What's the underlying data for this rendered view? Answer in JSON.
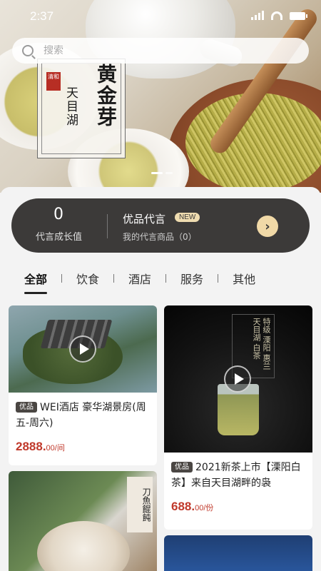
{
  "status_bar": {
    "time": "2:37"
  },
  "search": {
    "placeholder": "搜索"
  },
  "banner": {
    "seal_text": "清和",
    "brand_vertical": "天目湖",
    "product_vertical": "黄金芽"
  },
  "growth_card": {
    "value": "0",
    "value_label": "代言成长值",
    "title": "优品代言",
    "badge": "NEW",
    "subtitle": "我的代言商品（0）",
    "arrow": "›"
  },
  "tabs": [
    "全部",
    "饮食",
    "酒店",
    "服务",
    "其他"
  ],
  "products": [
    {
      "tag": "优品",
      "name": "WEI酒店 豪华湖景房(周五-周六)",
      "price": "2888.",
      "price_small": "00/间"
    },
    {
      "tag": "优品",
      "name": "2021新茶上市【溧阳白茶】来自天目湖畔的袅",
      "price": "688.",
      "price_small": "00/份",
      "image_text": "特级 溧阳 惠兰 天目湖 白茶"
    },
    {
      "image_text": "刀魚餛飩"
    }
  ],
  "colors": {
    "dark_card": "#3c3a39",
    "accent_gold": "#f1d9a7",
    "price_red": "#c0392b"
  }
}
